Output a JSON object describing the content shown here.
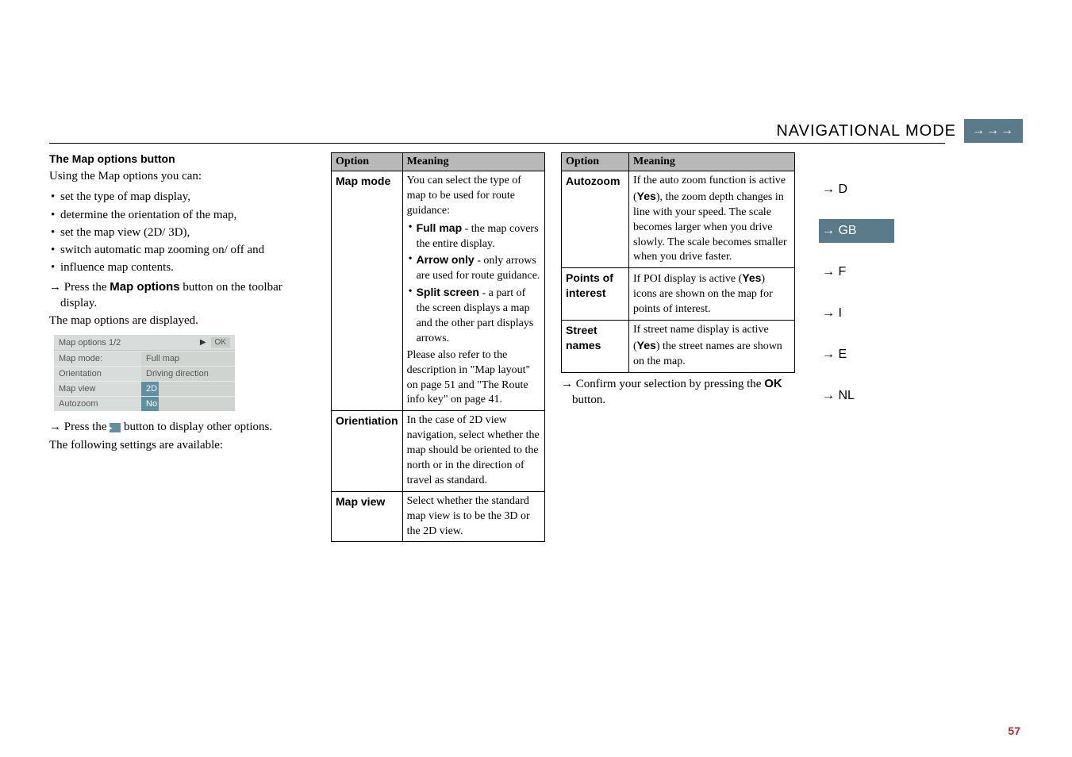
{
  "header": {
    "title": "NAVIGATIONAL MODE",
    "tab_symbol": "→→→"
  },
  "sidebar": {
    "items": [
      {
        "label": "→ D"
      },
      {
        "label": "→ GB"
      },
      {
        "label": "→ F"
      },
      {
        "label": "→ I"
      },
      {
        "label": "→ E"
      },
      {
        "label": "→ NL"
      }
    ],
    "active_index": 1
  },
  "col1": {
    "heading": "The Map options button",
    "intro": "Using the Map options you can:",
    "bullets": [
      "set the type of map display,",
      "determine the orientation of the map,",
      "set the map view (2D/ 3D),",
      "switch automatic map zooming on/ off and",
      "influence map contents."
    ],
    "instr1_pre": "Press the ",
    "instr1_bold": "Map options",
    "instr1_post": " button on the toolbar display.",
    "after_instr1": "The map options are displayed.",
    "screenshot": {
      "title": "Map options 1/2",
      "ok": "OK",
      "rows": [
        {
          "label": "Map mode:",
          "value": "Full map"
        },
        {
          "label": "Orientation",
          "value": "Driving direction"
        },
        {
          "label": "Map view",
          "value": "2D",
          "highlight": true
        },
        {
          "label": "Autozoom",
          "value": "No",
          "highlight": true
        }
      ]
    },
    "instr2_pre": "Press the ",
    "instr2_post": " button to display other options.",
    "after_instr2": "The following settings are available:"
  },
  "table1": {
    "h1": "Option",
    "h2": "Meaning",
    "rows": [
      {
        "option": "Map mode",
        "meaning_intro": "You can select the type of map to be used for route guidance:",
        "sub": [
          {
            "b": "Full map",
            "rest": " - the map covers the entire display."
          },
          {
            "b": "Arrow only",
            "rest": " - only arrows are used for route guidance."
          },
          {
            "b": "Split screen",
            "rest": " - a part of the screen displays a map and the other part displays arrows."
          }
        ],
        "meaning_tail": "Please also refer to the description in \"Map layout\" on page 51 and \"The Route info key\" on page 41."
      },
      {
        "option": "Orientiation",
        "meaning": "In the case of 2D view navigation, select whether the map should be oriented to the north or in the direction of travel as standard."
      },
      {
        "option": "Map view",
        "meaning": "Select whether the standard map view is to be the 3D or the 2D view."
      }
    ]
  },
  "table2": {
    "h1": "Option",
    "h2": "Meaning",
    "rows": [
      {
        "option": "Autozoom",
        "meaning_pre": "If the auto zoom function is active (",
        "meaning_bold": "Yes",
        "meaning_post": "), the zoom depth changes in line with your speed. The scale becomes larger when you drive slowly. The scale becomes smaller when you drive faster."
      },
      {
        "option": "Points of interest",
        "meaning_pre": "If POI display is active (",
        "meaning_bold": "Yes",
        "meaning_post": ") icons are shown on the map for points of interest."
      },
      {
        "option": "Street names",
        "meaning_pre": "If street name display is active (",
        "meaning_bold": "Yes",
        "meaning_post": ") the street names are shown on the map."
      }
    ],
    "confirm_pre": "Confirm your selection by pressing the ",
    "confirm_bold": "OK",
    "confirm_post": " button."
  },
  "page_number": "57"
}
